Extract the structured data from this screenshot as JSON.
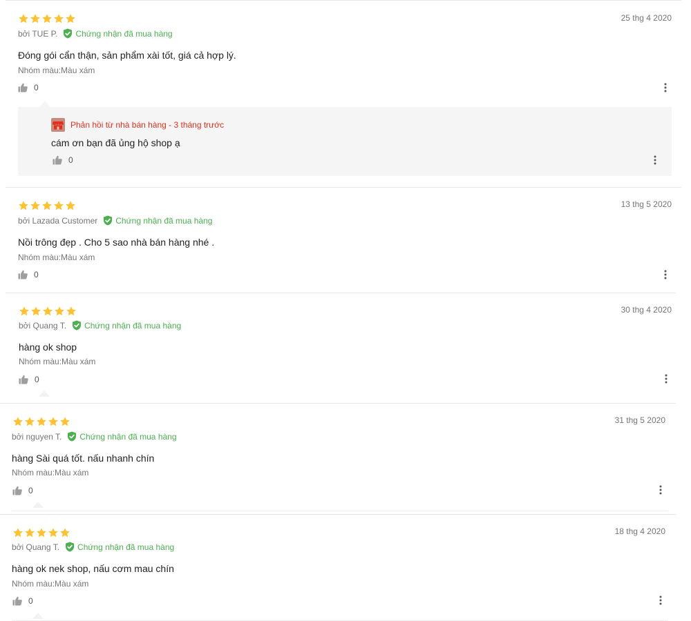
{
  "reviews": [
    {
      "rating": 5,
      "author": "bởi TUE P.",
      "verified": "Chứng nhận đã mua hàng",
      "date": "25 thg 4 2020",
      "content": "Đóng gói cẩn thận, sản phẩm xài tốt, giá cả hợp lý.",
      "sku": "Nhóm màu:Màu xám",
      "likes": "0",
      "reply": {
        "header": "Phản hồi từ nhà bán hàng - 3 tháng trước",
        "content": "cám ơn bạn đã ủng hộ shop ạ",
        "likes": "0"
      }
    },
    {
      "rating": 5,
      "author": "bởi Lazada Customer",
      "verified": "Chứng nhận đã mua hàng",
      "date": "13 thg 5 2020",
      "content": "Nồi trông đẹp . Cho 5 sao nhà bán hàng nhé .",
      "sku": "Nhóm màu:Màu xám",
      "likes": "0"
    },
    {
      "rating": 5,
      "author": "bởi Quang T.",
      "verified": "Chứng nhận đã mua hàng",
      "date": "30 thg 4 2020",
      "content": "hàng ok shop",
      "sku": "Nhóm màu:Màu xám",
      "likes": "0"
    },
    {
      "rating": 5,
      "author": "bởi nguyen T.",
      "verified": "Chứng nhận đã mua hàng",
      "date": "31 thg 5 2020",
      "content": "hàng Sài quá tốt. nấu nhanh chín",
      "sku": "Nhóm màu:Màu xám",
      "likes": "0"
    },
    {
      "rating": 5,
      "author": "bởi Quang T.",
      "verified": "Chứng nhận đã mua hàng",
      "date": "18 thg 4 2020",
      "content": "hàng ok nek shop, nấu cơm mau chín",
      "sku": "Nhóm màu:Màu xám",
      "likes": "0"
    }
  ],
  "colors": {
    "star": "#fdc234",
    "verified": "#4caf50",
    "reply_header": "#e0301e",
    "reply_bg": "#f5f5f5"
  },
  "icons": {
    "star": "star-icon",
    "verified": "verified-check-icon",
    "like": "thumbs-up-icon",
    "more": "more-vertical-icon",
    "shop": "shop-store-icon"
  }
}
